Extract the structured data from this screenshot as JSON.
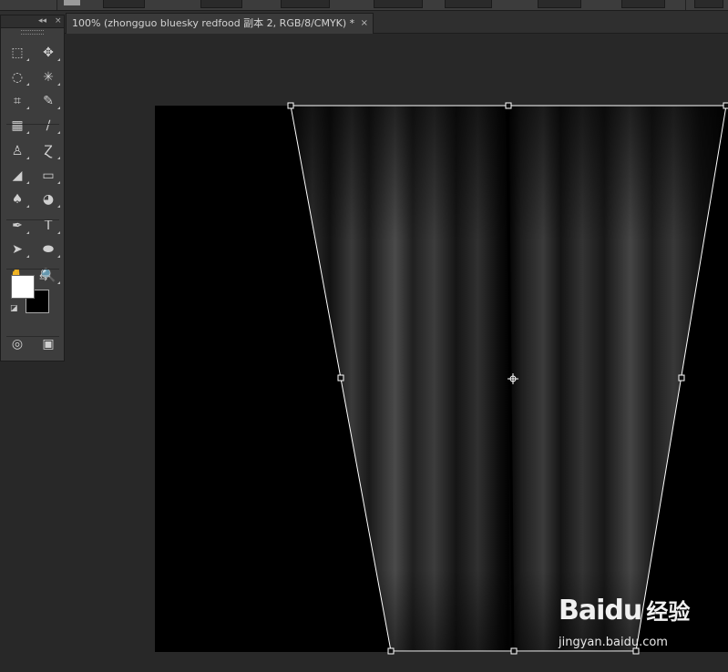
{
  "document_tab": {
    "title": "100% (zhongguo  bluesky  redfood 副本 2, RGB/8/CMYK) *",
    "close": "×"
  },
  "tools_panel": {
    "collapse_glyph": "◂◂",
    "close_glyph": "×",
    "tools": [
      {
        "name": "rectangular-marquee-icon",
        "glyph": "⬚"
      },
      {
        "name": "move-icon",
        "glyph": "✥"
      },
      {
        "name": "lasso-icon",
        "glyph": "◌"
      },
      {
        "name": "magic-wand-icon",
        "glyph": "✳"
      },
      {
        "name": "crop-icon",
        "glyph": "⌗"
      },
      {
        "name": "eyedropper-icon",
        "glyph": "✎"
      },
      {
        "name": "healing-brush-icon",
        "glyph": "▦"
      },
      {
        "name": "brush-icon",
        "glyph": "∕"
      },
      {
        "name": "clone-stamp-icon",
        "glyph": "♙"
      },
      {
        "name": "history-brush-icon",
        "glyph": "Ɀ"
      },
      {
        "name": "eraser-icon",
        "glyph": "◢"
      },
      {
        "name": "gradient-icon",
        "glyph": "▭"
      },
      {
        "name": "blur-icon",
        "glyph": "♠"
      },
      {
        "name": "dodge-icon",
        "glyph": "◕"
      },
      {
        "name": "pen-icon",
        "glyph": "✒"
      },
      {
        "name": "type-icon",
        "glyph": "T"
      },
      {
        "name": "path-selection-icon",
        "glyph": "➤"
      },
      {
        "name": "ellipse-icon",
        "glyph": "⬬"
      },
      {
        "name": "hand-icon",
        "glyph": "✋"
      },
      {
        "name": "zoom-icon",
        "glyph": "🔍"
      },
      {
        "name": "quick-mask-icon",
        "glyph": "◎"
      },
      {
        "name": "screen-mode-icon",
        "glyph": "▣"
      }
    ],
    "swap_glyph": "⇆",
    "default_colors_glyph": "◪"
  },
  "colors": {
    "foreground": "#ffffff",
    "background": "#000000",
    "canvas": "#000000",
    "workspace": "#282828"
  },
  "watermark": {
    "logo": "Bai",
    "logo_suffix": "du",
    "brand_cn": "经验",
    "url": "jingyan.baidu.com"
  }
}
